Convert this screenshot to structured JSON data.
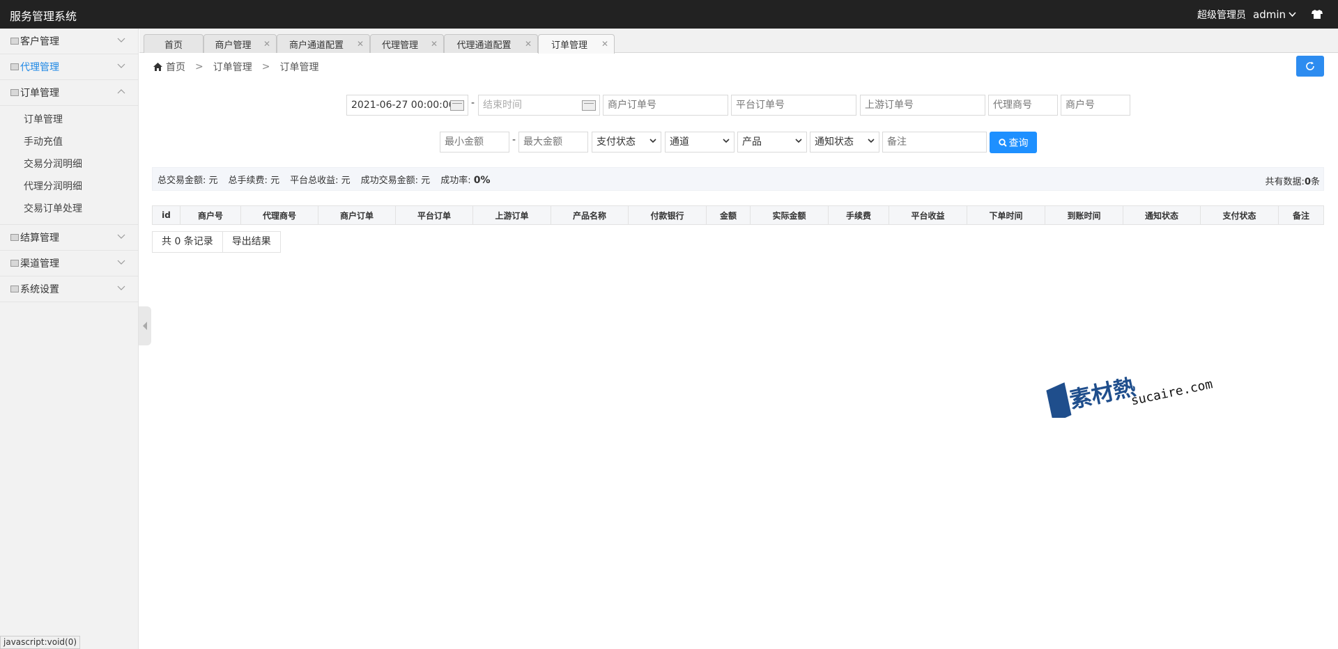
{
  "header": {
    "title": "服务管理系统",
    "role": "超级管理员",
    "user": "admin"
  },
  "sidebar": {
    "items": [
      {
        "label": "客户管理"
      },
      {
        "label": "代理管理"
      },
      {
        "label": "订单管理"
      },
      {
        "label": "结算管理"
      },
      {
        "label": "渠道管理"
      },
      {
        "label": "系统设置"
      }
    ],
    "order_submenu": [
      "订单管理",
      "手动充值",
      "交易分润明细",
      "代理分润明细",
      "交易订单处理"
    ]
  },
  "tabs": [
    "首页",
    "商户管理",
    "商户通道配置",
    "代理管理",
    "代理通道配置",
    "订单管理"
  ],
  "breadcrumb": [
    "首页",
    "订单管理",
    "订单管理"
  ],
  "filters": {
    "start_time": "2021-06-27 00:00:00",
    "end_time_placeholder": "结束时间",
    "merchant_order_placeholder": "商户订单号",
    "platform_order_placeholder": "平台订单号",
    "upstream_order_placeholder": "上游订单号",
    "agent_no_placeholder": "代理商号",
    "merchant_no_placeholder": "商户号",
    "min_amount_placeholder": "最小金额",
    "max_amount_placeholder": "最大金额",
    "pay_status": "支付状态",
    "channel": "通道",
    "product": "产品",
    "notify_status": "通知状态",
    "remark_placeholder": "备注",
    "query_label": "查询"
  },
  "stats": {
    "total_amount_label": "总交易金额:",
    "total_amount_unit": "元",
    "total_fee_label": "总手续费:",
    "total_fee_unit": "元",
    "platform_income_label": "平台总收益:",
    "platform_income_unit": "元",
    "success_amount_label": "成功交易金额:",
    "success_amount_unit": "元",
    "success_rate_label": "成功率:",
    "success_rate_value": "0%",
    "total_data_label": "共有数据:",
    "total_data_value": "0",
    "total_data_unit": "条"
  },
  "table": {
    "columns": [
      "id",
      "商户号",
      "代理商号",
      "商户订单",
      "平台订单",
      "上游订单",
      "产品名称",
      "付款银行",
      "金额",
      "实际金额",
      "手续费",
      "平台收益",
      "下单时间",
      "到账时间",
      "通知状态",
      "支付状态",
      "备注"
    ]
  },
  "pager": {
    "records": "共 0 条记录",
    "export": "导出结果"
  },
  "status_url": "javascript:void(0)",
  "watermark": {
    "brand": "素材熱",
    "domain": "sucaire.com"
  },
  "colors": {
    "header_bg": "#222222",
    "accent": "#1e90ff",
    "active_menu": "#1e88e5"
  }
}
